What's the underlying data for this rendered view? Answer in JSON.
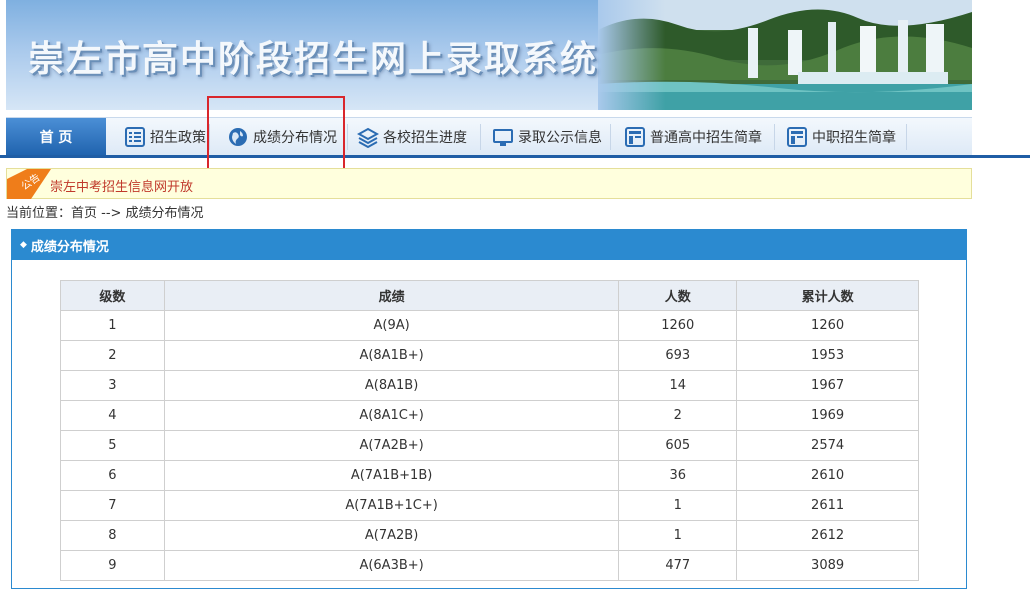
{
  "banner": {
    "title": "崇左市高中阶段招生网上录取系统"
  },
  "nav": {
    "items": [
      {
        "label": "首 页",
        "icon": "home"
      },
      {
        "label": "招生政策",
        "icon": "list-icon"
      },
      {
        "label": "成绩分布情况",
        "icon": "globe-icon"
      },
      {
        "label": "各校招生进度",
        "icon": "layers-icon"
      },
      {
        "label": "录取公示信息",
        "icon": "monitor-icon"
      },
      {
        "label": "普通高中招生简章",
        "icon": "document-icon"
      },
      {
        "label": "中职招生简章",
        "icon": "document-icon"
      }
    ]
  },
  "notice": {
    "badge": "公告",
    "text": "崇左中考招生信息网开放"
  },
  "breadcrumb": {
    "text": "当前位置：首页 --> 成绩分布情况"
  },
  "panel": {
    "title": "成绩分布情况"
  },
  "table": {
    "headers": [
      "级数",
      "成绩",
      "人数",
      "累计人数"
    ],
    "rows": [
      [
        "1",
        "A(9A)",
        "1260",
        "1260"
      ],
      [
        "2",
        "A(8A1B+)",
        "693",
        "1953"
      ],
      [
        "3",
        "A(8A1B)",
        "14",
        "1967"
      ],
      [
        "4",
        "A(8A1C+)",
        "2",
        "1969"
      ],
      [
        "5",
        "A(7A2B+)",
        "605",
        "2574"
      ],
      [
        "6",
        "A(7A1B+1B)",
        "36",
        "2610"
      ],
      [
        "7",
        "A(7A1B+1C+)",
        "1",
        "2611"
      ],
      [
        "8",
        "A(7A2B)",
        "1",
        "2612"
      ],
      [
        "9",
        "A(6A3B+)",
        "477",
        "3089"
      ]
    ]
  },
  "colors": {
    "nav_active": "#1f62ad",
    "panel_header": "#2b8ad0",
    "notice_text": "#c0392b",
    "highlight": "#d9262c"
  }
}
